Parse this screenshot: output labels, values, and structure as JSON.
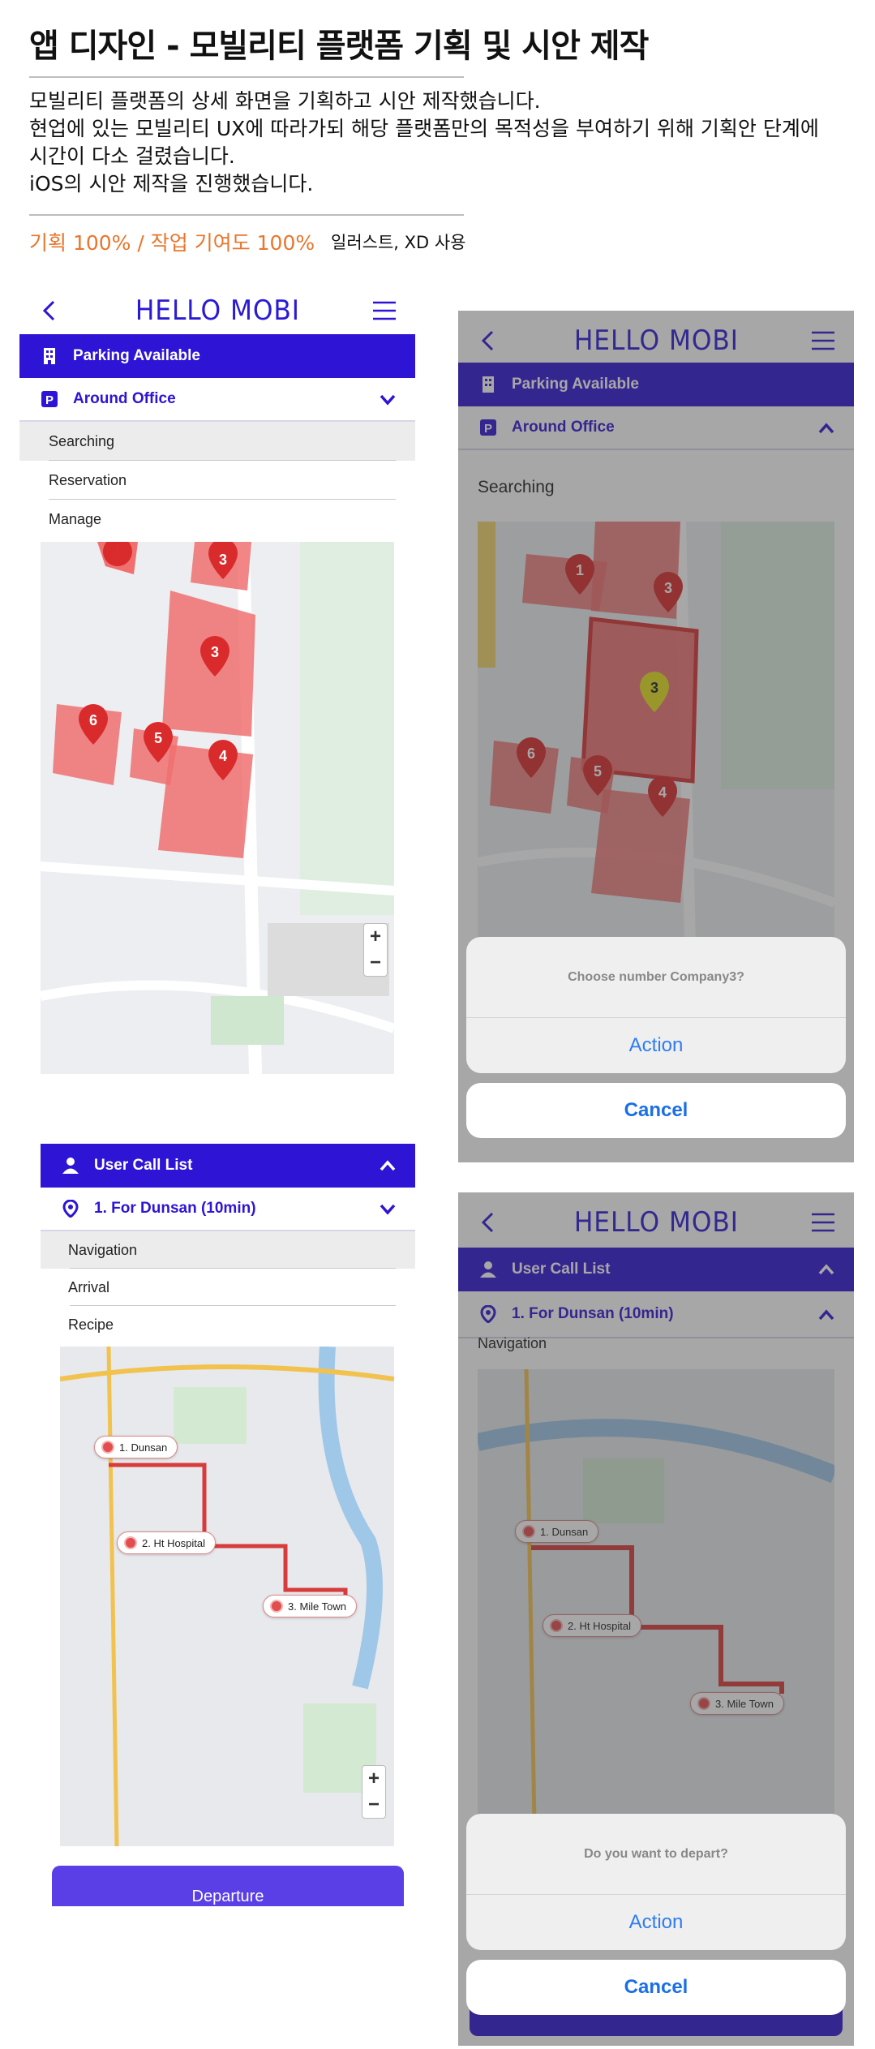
{
  "header": {
    "title": "앱 디자인 - 모빌리티 플랫폼 기획 및 시안 제작",
    "description": [
      "모빌리티 플랫폼의 상세 화면을 기획하고 시안 제작했습니다.",
      "현업에 있는 모빌리티 UX에 따라가되 해당 플랫폼만의 목적성을 부여하기 위해 기획안 단계에",
      "시간이 다소 걸렸습니다.",
      "iOS의 시안 제작을 진행했습니다."
    ],
    "credit": "기획 100% / 작업 기여도 100%",
    "tools": "일러스트, XD 사용"
  },
  "app": {
    "brand": "HELLO MOBI",
    "parking_bar": "Parking Available",
    "location_select": "Around Office",
    "menu": [
      "Searching",
      "Reservation",
      "Manage"
    ],
    "searching_title": "Searching",
    "user_call_bar": "User Call List",
    "route_select": "1. For Dunsan (10min)",
    "route_menu": [
      "Navigation",
      "Arrival",
      "Recipe"
    ],
    "departure_button": "Departure",
    "zoom_in": "+",
    "zoom_out": "−",
    "route_stops": [
      "1. Dunsan",
      "2. Ht Hospital",
      "3. Mile Town"
    ],
    "pins": [
      "1",
      "3",
      "3",
      "6",
      "5",
      "4"
    ]
  },
  "dialogs": {
    "company": {
      "question": "Choose number Company3?",
      "action": "Action",
      "cancel": "Cancel"
    },
    "depart": {
      "question": "Do you want to depart?",
      "action": "Action",
      "cancel": "Cancel"
    }
  },
  "colors": {
    "brand_purple": "#2e14d4",
    "accent_orange": "#e8762c",
    "action_blue": "#2f7cf0",
    "zone_red": "#f07070"
  }
}
